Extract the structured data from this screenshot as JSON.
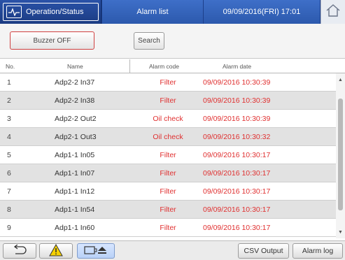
{
  "header": {
    "operation_label": "Operation/Status",
    "alarm_list_label": "Alarm list",
    "datetime": "09/09/2016(FRI) 17:01"
  },
  "toolbar": {
    "buzzer_label": "Buzzer OFF",
    "search_label": "Search"
  },
  "table": {
    "columns": {
      "no": "No.",
      "name": "Name",
      "code": "Alarm code",
      "date": "Alarm date"
    },
    "rows": [
      {
        "no": "1",
        "name": "Adp2-2 In37",
        "code": "Filter",
        "date": "09/09/2016 10:30:39"
      },
      {
        "no": "2",
        "name": "Adp2-2 In38",
        "code": "Filter",
        "date": "09/09/2016 10:30:39"
      },
      {
        "no": "3",
        "name": "Adp2-2 Out2",
        "code": "Oil check",
        "date": "09/09/2016 10:30:39"
      },
      {
        "no": "4",
        "name": "Adp2-1 Out3",
        "code": "Oil check",
        "date": "09/09/2016 10:30:32"
      },
      {
        "no": "5",
        "name": "Adp1-1 In05",
        "code": "Filter",
        "date": "09/09/2016 10:30:17"
      },
      {
        "no": "6",
        "name": "Adp1-1 In07",
        "code": "Filter",
        "date": "09/09/2016 10:30:17"
      },
      {
        "no": "7",
        "name": "Adp1-1 In12",
        "code": "Filter",
        "date": "09/09/2016 10:30:17"
      },
      {
        "no": "8",
        "name": "Adp1-1 In54",
        "code": "Filter",
        "date": "09/09/2016 10:30:17"
      },
      {
        "no": "9",
        "name": "Adp1-1 In60",
        "code": "Filter",
        "date": "09/09/2016 10:30:17"
      }
    ]
  },
  "footer": {
    "csv_label": "CSV Output",
    "log_label": "Alarm log"
  },
  "colors": {
    "header_bg": "#1d3f8a",
    "alarm_text": "#e03030",
    "buzzer_border": "#d04040",
    "row_alt": "#e2e2e2"
  },
  "icons": [
    "pulse-icon",
    "home-icon",
    "back-arrow-icon",
    "warning-icon",
    "display-eject-icon",
    "scroll-up-icon",
    "scroll-down-icon"
  ]
}
